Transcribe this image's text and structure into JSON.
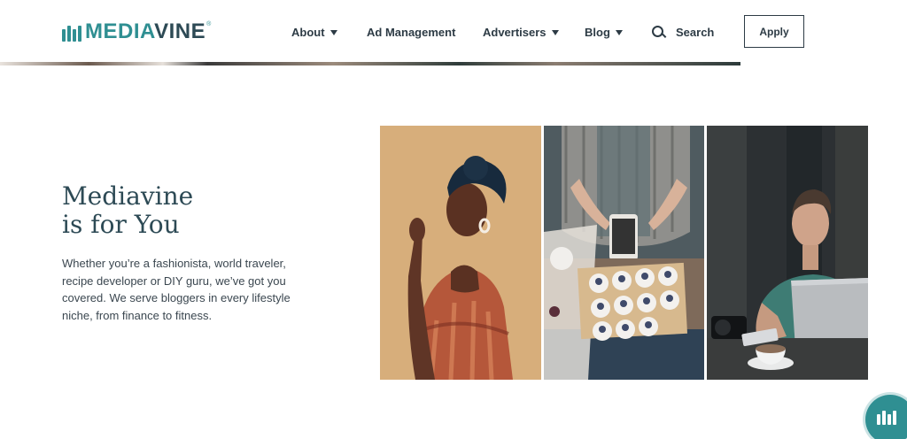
{
  "header": {
    "logo": {
      "text_main": "MEDIA",
      "text_accent": "VINE",
      "registered": "®"
    },
    "nav": [
      {
        "label": "About",
        "has_dropdown": true
      },
      {
        "label": "Ad Management",
        "has_dropdown": false
      },
      {
        "label": "Advertisers",
        "has_dropdown": true
      },
      {
        "label": "Blog",
        "has_dropdown": true
      }
    ],
    "search_label": "Search",
    "apply_label": "Apply"
  },
  "hero": {
    "headline_line1": "Mediavine",
    "headline_line2": "is for You",
    "body": "Whether you’re a fashionista, world traveler, recipe developer or DIY guru, we’ve got you covered. We serve bloggers in every lifestyle niche, from finance to fitness."
  },
  "photos": [
    {
      "icon": "fashion-portrait-photo"
    },
    {
      "icon": "food-blogger-photo"
    },
    {
      "icon": "laptop-traveler-photo"
    }
  ],
  "colors": {
    "brand_teal": "#2f8f92",
    "brand_dark": "#2d4a55",
    "text": "#2d3b45"
  },
  "chat": {
    "icon": "mediavine-chat-icon"
  }
}
